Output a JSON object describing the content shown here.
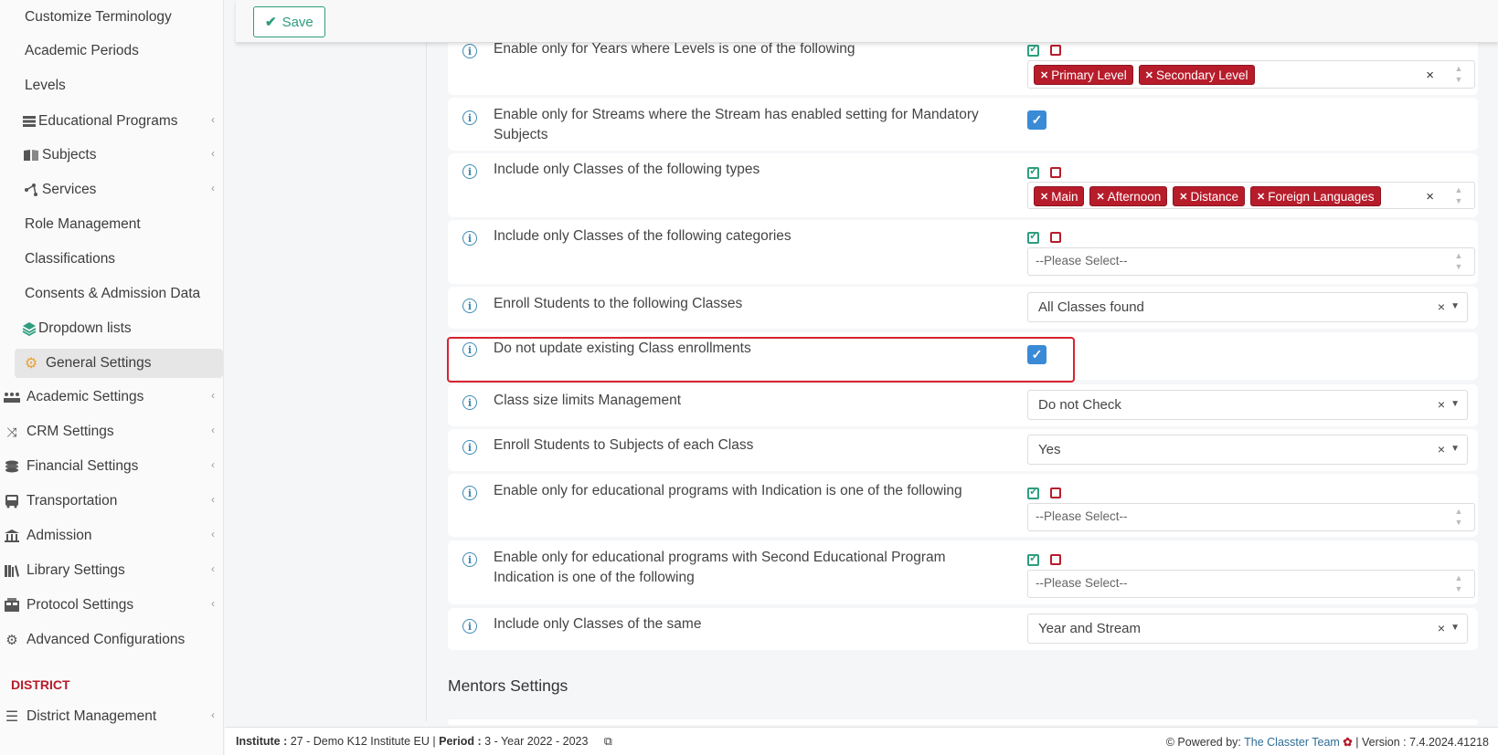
{
  "sidebar": {
    "items": [
      {
        "label": "Customize Terminology"
      },
      {
        "label": "Academic Periods"
      },
      {
        "label": "Levels"
      },
      {
        "label": "Educational Programs"
      },
      {
        "label": "Subjects"
      },
      {
        "label": "Services"
      },
      {
        "label": "Role Management"
      },
      {
        "label": "Classifications"
      },
      {
        "label": "Consents & Admission Data"
      },
      {
        "label": "Dropdown lists"
      },
      {
        "label": "General Settings"
      },
      {
        "label": "Academic Settings"
      },
      {
        "label": "CRM Settings"
      },
      {
        "label": "Financial Settings"
      },
      {
        "label": "Transportation"
      },
      {
        "label": "Admission"
      },
      {
        "label": "Library Settings"
      },
      {
        "label": "Protocol Settings"
      },
      {
        "label": "Advanced Configurations"
      }
    ],
    "section": "DISTRICT",
    "district_item": "District Management"
  },
  "toolbar": {
    "save_label": "Save"
  },
  "settings": [
    {
      "label": "Enable only for Years where Levels is one of the following",
      "tags": [
        "Primary Level",
        "Secondary Level"
      ]
    },
    {
      "label": "Enable only for Streams where the Stream has enabled setting for Mandatory Subjects"
    },
    {
      "label": "Include only Classes of the following types",
      "tags": [
        "Main",
        "Afternoon",
        "Distance",
        "Foreign Languages"
      ]
    },
    {
      "label": "Include only Classes of the following categories",
      "placeholder": "--Please Select--"
    },
    {
      "label": "Enroll Students to the following Classes",
      "value": "All Classes found"
    },
    {
      "label": "Do not update existing Class enrollments"
    },
    {
      "label": "Class size limits Management",
      "value": "Do not Check"
    },
    {
      "label": "Enroll Students to Subjects of each Class",
      "value": "Yes"
    },
    {
      "label": "Enable only for educational programs with Indication is one of the following",
      "placeholder": "--Please Select--"
    },
    {
      "label": "Enable only for educational programs with Second Educational Program Indication is one of the following",
      "placeholder": "--Please Select--"
    },
    {
      "label": "Include only Classes of the same",
      "value": "Year and Stream"
    }
  ],
  "mentors_title": "Mentors Settings",
  "footer": {
    "institute_label": "Institute :",
    "institute_value": "27 - Demo K12 Institute EU",
    "period_label": "Period :",
    "period_value": "3 - Year 2022 - 2023",
    "powered_by": "Powered by:",
    "team": "The Classter Team",
    "version": "| Version : 7.4.2024.41218"
  },
  "colors": {
    "accent": "#2e9d7e",
    "tag": "#b71c2b",
    "checkbox": "#3a8ad6",
    "highlight": "#d9232f"
  }
}
